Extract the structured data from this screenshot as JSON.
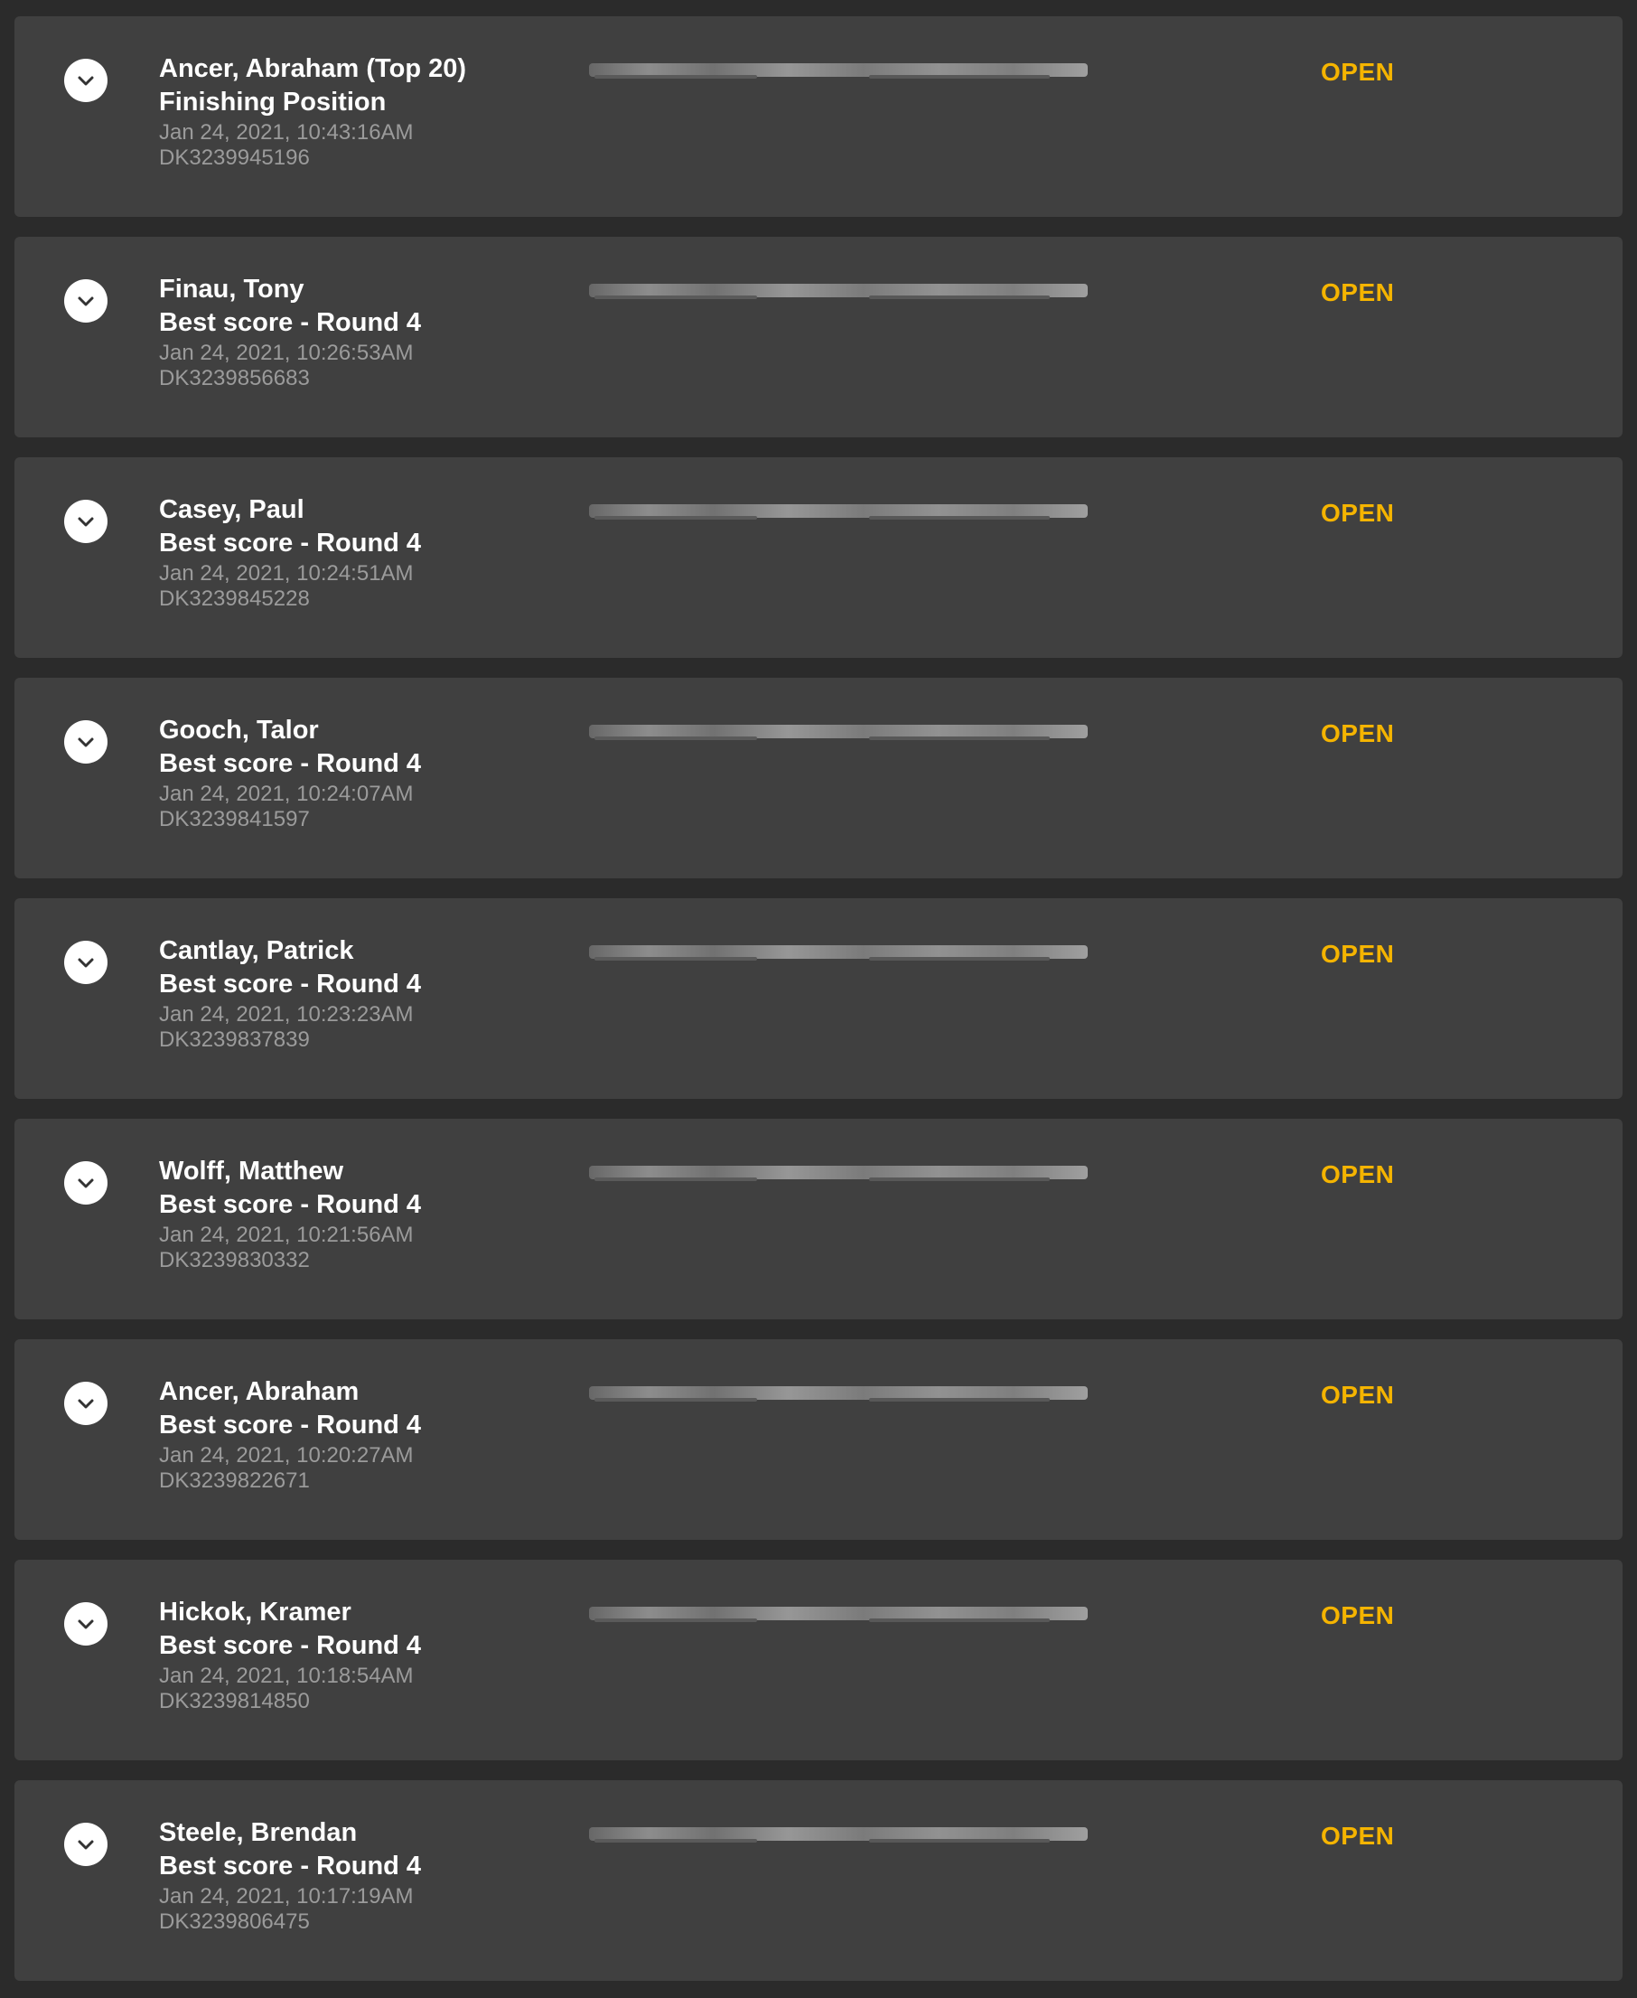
{
  "wagers": [
    {
      "name": "Ancer, Abraham (Top 20)",
      "market": "Finishing Position",
      "date": "Jan 24, 2021, 10:43:16AM",
      "id": "DK3239945196",
      "status": "OPEN"
    },
    {
      "name": "Finau, Tony",
      "market": "Best score - Round 4",
      "date": "Jan 24, 2021, 10:26:53AM",
      "id": "DK3239856683",
      "status": "OPEN"
    },
    {
      "name": "Casey, Paul",
      "market": "Best score - Round 4",
      "date": "Jan 24, 2021, 10:24:51AM",
      "id": "DK3239845228",
      "status": "OPEN"
    },
    {
      "name": "Gooch, Talor",
      "market": "Best score - Round 4",
      "date": "Jan 24, 2021, 10:24:07AM",
      "id": "DK3239841597",
      "status": "OPEN"
    },
    {
      "name": "Cantlay, Patrick",
      "market": "Best score - Round 4",
      "date": "Jan 24, 2021, 10:23:23AM",
      "id": "DK3239837839",
      "status": "OPEN"
    },
    {
      "name": "Wolff, Matthew",
      "market": "Best score - Round 4",
      "date": "Jan 24, 2021, 10:21:56AM",
      "id": "DK3239830332",
      "status": "OPEN"
    },
    {
      "name": "Ancer, Abraham",
      "market": "Best score - Round 4",
      "date": "Jan 24, 2021, 10:20:27AM",
      "id": "DK3239822671",
      "status": "OPEN"
    },
    {
      "name": "Hickok, Kramer",
      "market": "Best score - Round 4",
      "date": "Jan 24, 2021, 10:18:54AM",
      "id": "DK3239814850",
      "status": "OPEN"
    },
    {
      "name": "Steele, Brendan",
      "market": "Best score - Round 4",
      "date": "Jan 24, 2021, 10:17:19AM",
      "id": "DK3239806475",
      "status": "OPEN"
    }
  ],
  "icons": {
    "expand": "chevron-down-icon"
  },
  "colors": {
    "page_background": "#2b2b2b",
    "card_background": "#404040",
    "status_open": "#f5b400",
    "primary_text": "#ffffff",
    "secondary_text": "#9b9b9b"
  }
}
